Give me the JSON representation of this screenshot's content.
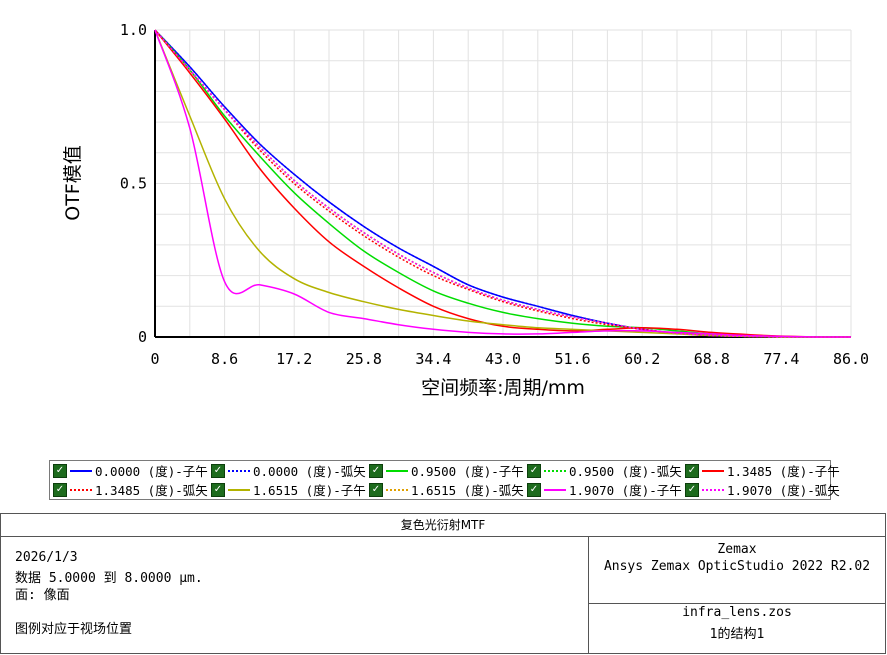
{
  "chart_data": {
    "type": "line",
    "xlabel": "空间频率:周期/mm",
    "ylabel": "OTF模值",
    "xlim": [
      0,
      86.0
    ],
    "ylim": [
      0,
      1.0
    ],
    "xticks": [
      "0",
      "8.6",
      "17.2",
      "25.8",
      "34.4",
      "43.0",
      "51.6",
      "60.2",
      "68.8",
      "77.4",
      "86.0"
    ],
    "yticks": [
      "0",
      "0.5",
      "1.0"
    ],
    "grid": true,
    "x": [
      0,
      4.3,
      8.6,
      12.9,
      17.2,
      21.5,
      25.8,
      30.1,
      34.4,
      38.7,
      43.0,
      47.3,
      51.6,
      55.9,
      60.2,
      64.5,
      68.8,
      73.1,
      77.4,
      81.7,
      86.0
    ],
    "series": [
      {
        "name": "0.0000 (度)-子午",
        "color": "#0000ff",
        "dash": false,
        "values": [
          1.0,
          0.88,
          0.75,
          0.63,
          0.53,
          0.44,
          0.36,
          0.29,
          0.23,
          0.17,
          0.13,
          0.1,
          0.07,
          0.045,
          0.025,
          0.012,
          0.005,
          0.002,
          0.0,
          0.0,
          0.0
        ]
      },
      {
        "name": "0.0000 (度)-弧矢",
        "color": "#0000ff",
        "dash": true,
        "values": [
          1.0,
          0.88,
          0.75,
          0.63,
          0.53,
          0.44,
          0.36,
          0.29,
          0.23,
          0.17,
          0.13,
          0.1,
          0.07,
          0.045,
          0.025,
          0.012,
          0.005,
          0.002,
          0.0,
          0.0,
          0.0
        ]
      },
      {
        "name": "0.9500 (度)-子午",
        "color": "#00dd00",
        "dash": false,
        "values": [
          1.0,
          0.87,
          0.72,
          0.59,
          0.47,
          0.37,
          0.28,
          0.21,
          0.15,
          0.11,
          0.08,
          0.06,
          0.045,
          0.035,
          0.03,
          0.02,
          0.01,
          0.005,
          0.0,
          0.0,
          0.0
        ]
      },
      {
        "name": "0.9500 (度)-弧矢",
        "color": "#00dd00",
        "dash": true,
        "values": [
          1.0,
          0.87,
          0.74,
          0.62,
          0.51,
          0.42,
          0.34,
          0.27,
          0.21,
          0.16,
          0.12,
          0.09,
          0.065,
          0.045,
          0.025,
          0.012,
          0.005,
          0.002,
          0.0,
          0.0,
          0.0
        ]
      },
      {
        "name": "1.3485 (度)-子午",
        "color": "#ff0000",
        "dash": false,
        "values": [
          1.0,
          0.86,
          0.71,
          0.55,
          0.42,
          0.31,
          0.23,
          0.16,
          0.1,
          0.06,
          0.035,
          0.025,
          0.02,
          0.025,
          0.03,
          0.025,
          0.015,
          0.008,
          0.003,
          0.0,
          0.0
        ]
      },
      {
        "name": "1.3485 (度)-弧矢",
        "color": "#ff0000",
        "dash": true,
        "values": [
          1.0,
          0.87,
          0.74,
          0.61,
          0.5,
          0.41,
          0.33,
          0.26,
          0.2,
          0.155,
          0.115,
          0.085,
          0.06,
          0.04,
          0.025,
          0.012,
          0.005,
          0.002,
          0.0,
          0.0,
          0.0
        ]
      },
      {
        "name": "1.6515 (度)-子午",
        "color": "#b3b300",
        "dash": false,
        "values": [
          1.0,
          0.72,
          0.45,
          0.28,
          0.19,
          0.145,
          0.115,
          0.09,
          0.07,
          0.052,
          0.04,
          0.03,
          0.025,
          0.02,
          0.015,
          0.01,
          0.005,
          0.002,
          0.0,
          0.0,
          0.0
        ]
      },
      {
        "name": "1.6515 (度)-弧矢",
        "color": "#e0a000",
        "dash": true,
        "values": [
          1.0,
          0.87,
          0.74,
          0.62,
          0.51,
          0.42,
          0.34,
          0.27,
          0.21,
          0.16,
          0.12,
          0.09,
          0.065,
          0.045,
          0.025,
          0.012,
          0.005,
          0.002,
          0.0,
          0.0,
          0.0
        ]
      },
      {
        "name": "1.9070 (度)-子午",
        "color": "#ff00ff",
        "dash": false,
        "values": [
          1.0,
          0.68,
          0.18,
          0.17,
          0.14,
          0.08,
          0.06,
          0.04,
          0.025,
          0.015,
          0.01,
          0.01,
          0.015,
          0.02,
          0.02,
          0.015,
          0.01,
          0.005,
          0.002,
          0.0,
          0.0
        ]
      },
      {
        "name": "1.9070 (度)-弧矢",
        "color": "#ff00ff",
        "dash": true,
        "values": [
          1.0,
          0.87,
          0.74,
          0.62,
          0.51,
          0.42,
          0.34,
          0.27,
          0.21,
          0.16,
          0.12,
          0.09,
          0.065,
          0.045,
          0.025,
          0.012,
          0.005,
          0.002,
          0.0,
          0.0,
          0.0
        ]
      }
    ]
  },
  "info": {
    "title": "复色光衍射MTF",
    "date": "2026/1/3",
    "data_line": "数据 5.0000 到 8.0000 μm.",
    "surface_line": "面: 像面",
    "legend_note": "图例对应于视场位置",
    "vendor": "Zemax",
    "product": "Ansys Zemax OpticStudio 2022 R2.02",
    "file": "infra_lens.zos",
    "config": "1的结构1"
  },
  "legend_check_glyph": "✓"
}
